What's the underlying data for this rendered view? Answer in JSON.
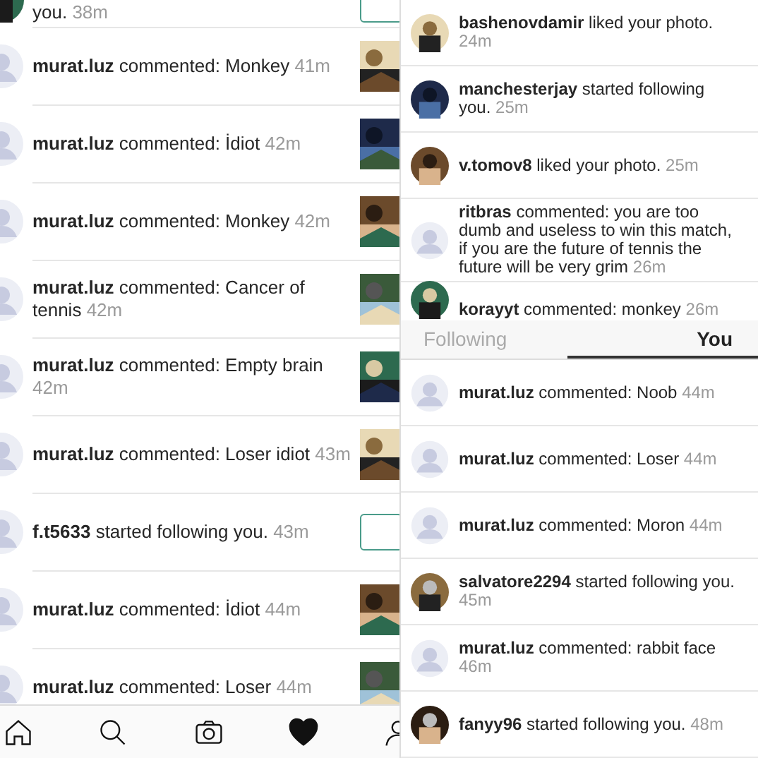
{
  "left_panel": {
    "items": [
      {
        "text": "you.",
        "time": "38m",
        "thumb": {
          "kind": "follow"
        }
      },
      {
        "avatar": {
          "kind": "default"
        },
        "text": "**murat.luz** commented: Monkey",
        "time": "41m"
      },
      {
        "avatar": {
          "kind": "default"
        },
        "text": "**murat.luz** commented: İdiot",
        "time": "42m"
      },
      {
        "avatar": {
          "kind": "default"
        },
        "text": "**murat.luz** commented: Monkey",
        "time": "42m"
      },
      {
        "avatar": {
          "kind": "default"
        },
        "text": "**murat.luz** commented: Cancer of tennis",
        "time": "42m"
      },
      {
        "avatar": {
          "kind": "default"
        },
        "text": "**murat.luz** commented: Empty brain",
        "time": "42m"
      },
      {
        "avatar": {
          "kind": "default"
        },
        "text": "**murat.luz** commented: Loser idiot",
        "time": "43m"
      },
      {
        "avatar": {
          "kind": "default"
        },
        "text": "**f.t5633** started following you.",
        "time": "43m",
        "thumb": {
          "kind": "follow"
        }
      },
      {
        "avatar": {
          "kind": "default"
        },
        "text": "**murat.luz** commented: İdiot",
        "time": "44m"
      },
      {
        "avatar": {
          "kind": "default"
        },
        "text": "**murat.luz** commented: Loser",
        "time": "44m"
      }
    ],
    "nav": [
      {
        "kind": "home",
        "selected": false
      },
      {
        "kind": "search",
        "selected": false
      },
      {
        "kind": "camera",
        "selected": false
      },
      {
        "kind": "heart",
        "selected": true
      },
      {
        "kind": "profile",
        "selected": false
      }
    ]
  },
  "right_panel": {
    "items_top": [
      {
        "text": "**bashenovdamir** liked your photo.",
        "time": "24m"
      },
      {
        "text": "**manchesterjay** started following you.",
        "time": "25m"
      },
      {
        "text": "**v.tomov8** liked your photo.",
        "time": "25m"
      },
      {
        "avatar": {
          "kind": "default"
        },
        "text": "**ritbras** commented: you are too dumb and useless to win this match,  if you are the future of tennis the future will be very grim",
        "time": "26m"
      },
      {
        "text": "**korayyt** commented: monkey",
        "time": "26m"
      }
    ],
    "tabs": [
      {
        "label": "Following",
        "selected": false
      },
      {
        "label": "You",
        "selected": true
      }
    ],
    "items_bottom": [
      {
        "avatar": {
          "kind": "default"
        },
        "text": "**murat.luz** commented: Noob",
        "time": "44m"
      },
      {
        "avatar": {
          "kind": "default"
        },
        "text": "**murat.luz** commented: Loser",
        "time": "44m"
      },
      {
        "avatar": {
          "kind": "default"
        },
        "text": "**murat.luz** commented: Moron",
        "time": "44m"
      },
      {
        "text": "**salvatore2294** started following you.",
        "time": "45m"
      },
      {
        "avatar": {
          "kind": "default"
        },
        "text": "**murat.luz** commented: rabbit face",
        "time": "46m"
      },
      {
        "text": "**fanyy96** started following you.",
        "time": "48m"
      }
    ]
  }
}
